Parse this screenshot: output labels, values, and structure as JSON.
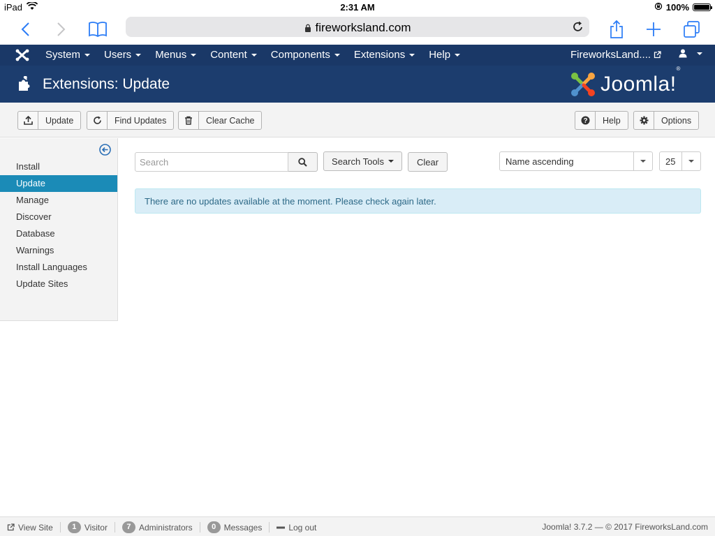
{
  "status_bar": {
    "device": "iPad",
    "time": "2:31 AM",
    "battery": "100%",
    "battery_level": 1.0
  },
  "safari": {
    "url": "fireworksland.com"
  },
  "topnav": {
    "menu": [
      {
        "label": "System"
      },
      {
        "label": "Users"
      },
      {
        "label": "Menus"
      },
      {
        "label": "Content"
      },
      {
        "label": "Components"
      },
      {
        "label": "Extensions"
      },
      {
        "label": "Help"
      }
    ],
    "site_name": "FireworksLand...."
  },
  "header": {
    "title": "Extensions: Update",
    "brand": "Joomla!",
    "brand_reg": "®"
  },
  "toolbar": {
    "update": "Update",
    "find_updates": "Find Updates",
    "clear_cache": "Clear Cache",
    "help": "Help",
    "options": "Options"
  },
  "sidebar": {
    "items": [
      {
        "label": "Install",
        "active": false
      },
      {
        "label": "Update",
        "active": true
      },
      {
        "label": "Manage",
        "active": false
      },
      {
        "label": "Discover",
        "active": false
      },
      {
        "label": "Database",
        "active": false
      },
      {
        "label": "Warnings",
        "active": false
      },
      {
        "label": "Install Languages",
        "active": false
      },
      {
        "label": "Update Sites",
        "active": false
      }
    ]
  },
  "filters": {
    "search_placeholder": "Search",
    "search_value": "",
    "search_tools": "Search Tools",
    "clear": "Clear",
    "ordering": "Name ascending",
    "limit": "25"
  },
  "message": "There are no updates available at the moment. Please check again later.",
  "footer": {
    "view_site": "View Site",
    "visitors_count": "1",
    "visitors_label": "Visitor",
    "admins_count": "7",
    "admins_label": "Administrators",
    "messages_count": "0",
    "messages_label": "Messages",
    "logout": "Log out",
    "copyright": "Joomla! 3.7.2  —  © 2017 FireworksLand.com"
  },
  "colors": {
    "navbar": "#1a3867",
    "header": "#1c3d6e",
    "sidebar_active": "#1b8bb7",
    "ios_blue": "#2b7cf6",
    "alert_bg": "#d9edf7",
    "alert_text": "#2d6987"
  },
  "icons": {
    "back": "chevron-left-icon",
    "forward": "chevron-right-icon",
    "bookmarks": "book-icon",
    "lock": "lock-icon",
    "reload": "reload-icon",
    "share": "share-icon",
    "new_tab": "plus-icon",
    "tabs": "tabs-icon",
    "joomla_menu": "joomla-logo-icon",
    "page": "puzzle-icon",
    "upload": "upload-icon",
    "refresh": "refresh-icon",
    "trash": "trash-icon",
    "question": "question-icon",
    "gear": "gear-icon",
    "search": "search-icon",
    "collapse": "arrow-circle-left-icon",
    "external": "external-link-icon",
    "user": "user-icon",
    "minus": "minus-icon"
  }
}
